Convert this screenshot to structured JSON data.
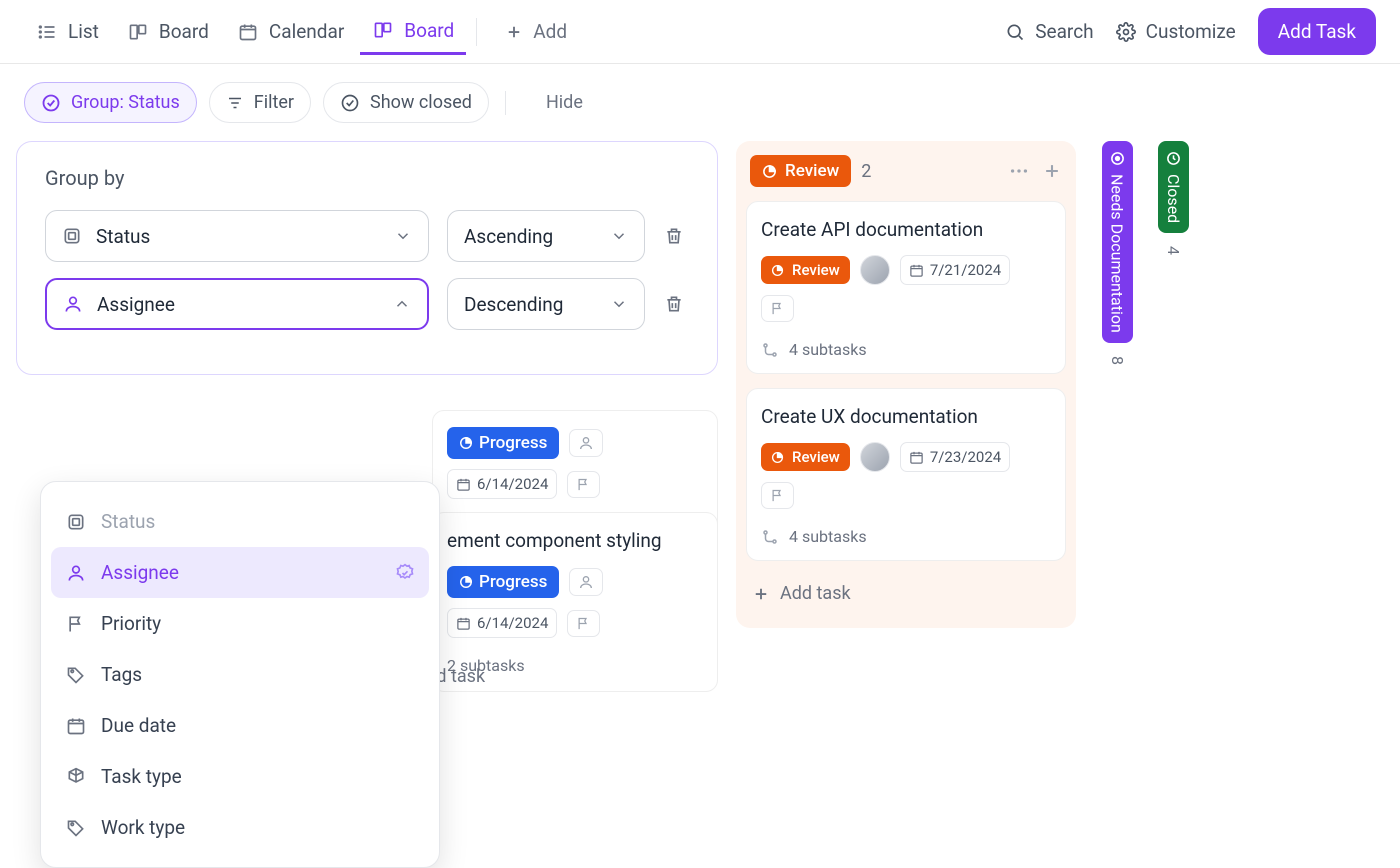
{
  "views": {
    "list": "List",
    "board": "Board",
    "calendar": "Calendar",
    "board2": "Board",
    "add": "Add"
  },
  "nav": {
    "search": "Search",
    "customize": "Customize",
    "add_task": "Add Task"
  },
  "filters": {
    "group": "Group: Status",
    "filter": "Filter",
    "show_closed": "Show closed",
    "hide": "Hide"
  },
  "panel": {
    "title": "Group by",
    "row1_field": "Status",
    "row1_sort": "Ascending",
    "row2_field": "Assignee",
    "row2_sort": "Descending"
  },
  "dropdown": {
    "status": "Status",
    "assignee": "Assignee",
    "priority": "Priority",
    "tags": "Tags",
    "due_date": "Due date",
    "task_type": "Task type",
    "work_type": "Work type"
  },
  "review": {
    "label": "Review",
    "count": "2",
    "card1": {
      "title": "Create API documentation",
      "status": "Review",
      "date": "7/21/2024",
      "sub": "4 subtasks"
    },
    "card2": {
      "title": "Create UX documentation",
      "status": "Review",
      "date": "7/23/2024",
      "sub": "4 subtasks"
    },
    "add": "Add task"
  },
  "collapsed": {
    "needs_doc": "Needs Documentation",
    "needs_doc_n": "8",
    "closed": "Closed",
    "closed_n": "4"
  },
  "behind": {
    "c1_status": "Progress",
    "c1_date": "6/14/2024",
    "c1_sub": "2 subtasks",
    "c2_title": "ement component styling",
    "c2_status": "Progress",
    "c2_date": "6/14/2024",
    "c2_sub": "2 subtasks",
    "add": "ld task"
  }
}
